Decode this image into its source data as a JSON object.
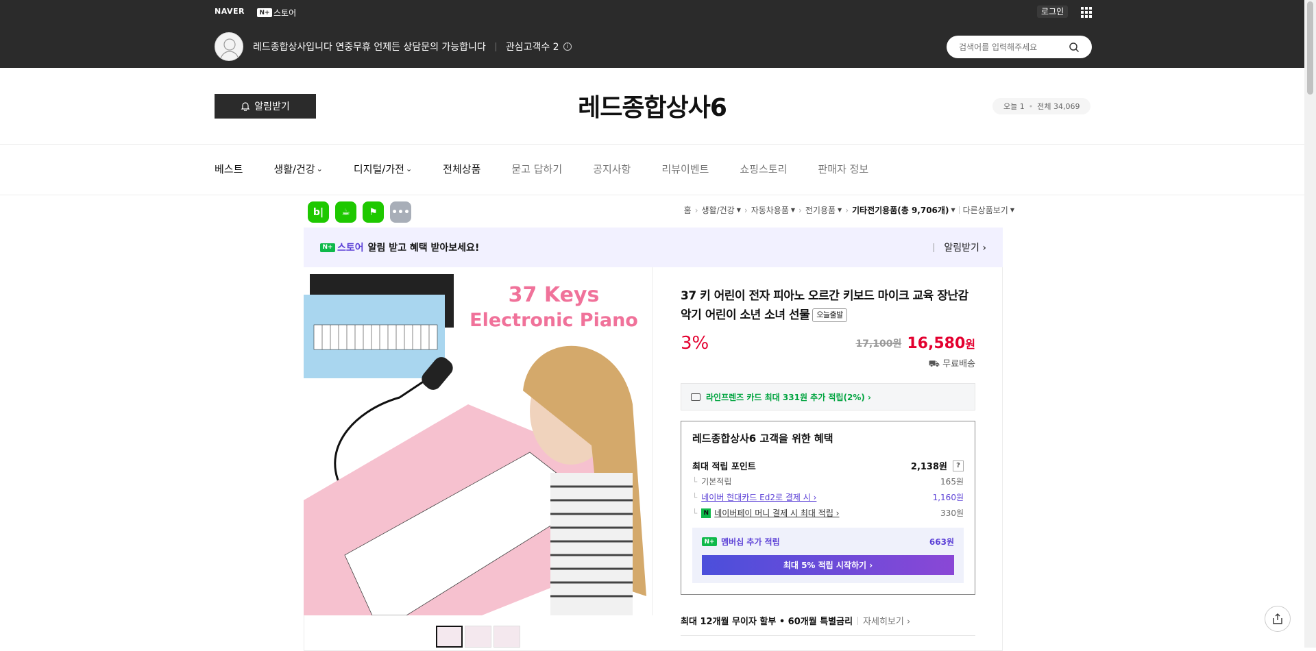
{
  "gnb": {
    "naver_logo": "NAVER",
    "nplus_badge": "N+",
    "store_label": "스토어",
    "login": "로그인",
    "store_desc": "레드종합상사입니다 연중무휴 언제든 상담문의 가능합니다",
    "interest": "관심고객수 2",
    "search_placeholder": "검색어를 입력해주세요"
  },
  "store": {
    "alarm_btn": "알림받기",
    "title": "레드종합상사6",
    "visitors_today": "오늘 1",
    "visitors_total": "전체 34,069"
  },
  "nav": [
    {
      "label": "베스트",
      "dropdown": false,
      "muted": false
    },
    {
      "label": "생활/건강",
      "dropdown": true,
      "muted": false
    },
    {
      "label": "디지털/가전",
      "dropdown": true,
      "muted": false
    },
    {
      "label": "전체상품",
      "dropdown": false,
      "muted": false
    },
    {
      "label": "묻고 답하기",
      "dropdown": false,
      "muted": true
    },
    {
      "label": "공지사항",
      "dropdown": false,
      "muted": true
    },
    {
      "label": "리뷰이벤트",
      "dropdown": false,
      "muted": true
    },
    {
      "label": "쇼핑스토리",
      "dropdown": false,
      "muted": true
    },
    {
      "label": "판매자 정보",
      "dropdown": false,
      "muted": true
    }
  ],
  "share_icons": [
    {
      "name": "blog-icon",
      "glyph": "b|",
      "color": "#1ec800"
    },
    {
      "name": "cafe-icon",
      "glyph": "☕",
      "color": "#1ec800"
    },
    {
      "name": "bookmark-icon",
      "glyph": "⚑",
      "color": "#1ec800"
    },
    {
      "name": "more-icon",
      "glyph": "•••",
      "color": "#a8aeb8"
    }
  ],
  "breadcrumb": {
    "home": "홈",
    "c1": "생활/건강",
    "c2": "자동차용품",
    "c3": "전기용품",
    "c4": "기타전기용품",
    "count": "(총 9,706개)",
    "other": "다른상품보기"
  },
  "banner": {
    "store": "스토어",
    "text": "알림 받고 혜택 받아보세요!",
    "action": "알림받기 ›"
  },
  "product": {
    "image_caption_line1": "37 Keys",
    "image_caption_line2": "Electronic Piano",
    "title": "37 키 어린이 전자 피아노 오르간 키보드 마이크 교육 장난감 악기 어린이 소년 소녀 선물",
    "badge": "오늘출발",
    "discount": "3%",
    "original_price": "17,100원",
    "sale_price": "16,580",
    "sale_unit": "원",
    "shipping": "무료배송",
    "card_promo": "라인프렌즈 카드 최대 331원 추가 적립(2%) ›"
  },
  "benefit": {
    "title": "레드종합상사6 고객을 위한 혜택",
    "max_points_label": "최대 적립 포인트",
    "max_points_value": "2,138원",
    "q": "?",
    "rows": [
      {
        "label": "기본적립",
        "value": "165원"
      },
      {
        "label": "네이버 현대카드 Ed2로 결제 시 ›",
        "value": "1,160원"
      },
      {
        "label": "네이버페이 머니 결제 시 최대 적립 ›",
        "value": "330원"
      }
    ],
    "member_label": "멤버십 추가 적립",
    "member_value": "663원",
    "cta": "최대 5% 적립 시작하기 ›"
  },
  "installment": {
    "text": "최대 12개월 무이자 할부 • 60개월 특별금리",
    "more": "자세히보기 ›"
  }
}
